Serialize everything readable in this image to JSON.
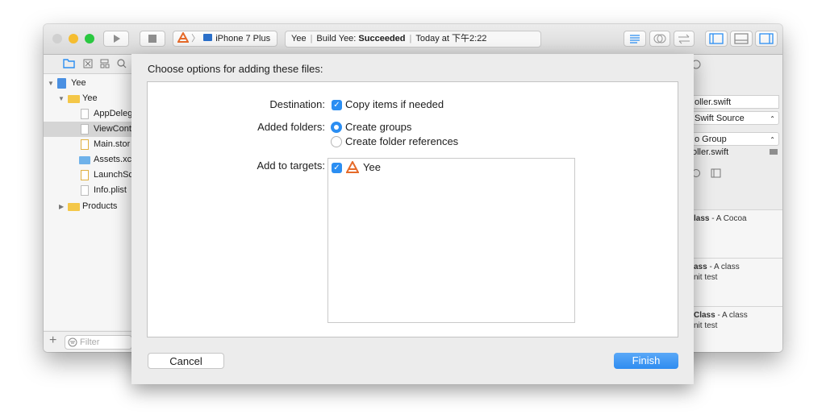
{
  "toolbar": {
    "device": "iPhone 7 Plus",
    "status_project": "Yee",
    "status_build": "Build Yee:",
    "status_result": "Succeeded",
    "status_time": "Today at 下午2:22"
  },
  "navigator": {
    "project": "Yee",
    "group": "Yee",
    "files": [
      "AppDeleg",
      "ViewCont",
      "Main.stor",
      "Assets.xc",
      "LaunchSc",
      "Info.plist"
    ],
    "products": "Products",
    "filter_placeholder": "Filter"
  },
  "inspector": {
    "filename": "oller.swift",
    "type": "Swift Source",
    "location": "o Group",
    "path": "oller.swift",
    "library": [
      {
        "title": "lass",
        "desc": " - A Cocoa",
        "desc2": ""
      },
      {
        "title": "ass",
        "desc": " - A class",
        "desc2": "nit test"
      },
      {
        "title": "Class",
        "desc": " - A class",
        "desc2": "nit test"
      }
    ]
  },
  "sheet": {
    "title": "Choose options for adding these files:",
    "destination_label": "Destination:",
    "copy_items": "Copy items if needed",
    "added_folders_label": "Added folders:",
    "create_groups": "Create groups",
    "create_folder_refs": "Create folder references",
    "add_targets_label": "Add to targets:",
    "target_name": "Yee",
    "cancel": "Cancel",
    "finish": "Finish"
  },
  "colors": {
    "accent": "#2b8ef2",
    "finish": "#3d96f5",
    "folder": "#f4c748"
  }
}
